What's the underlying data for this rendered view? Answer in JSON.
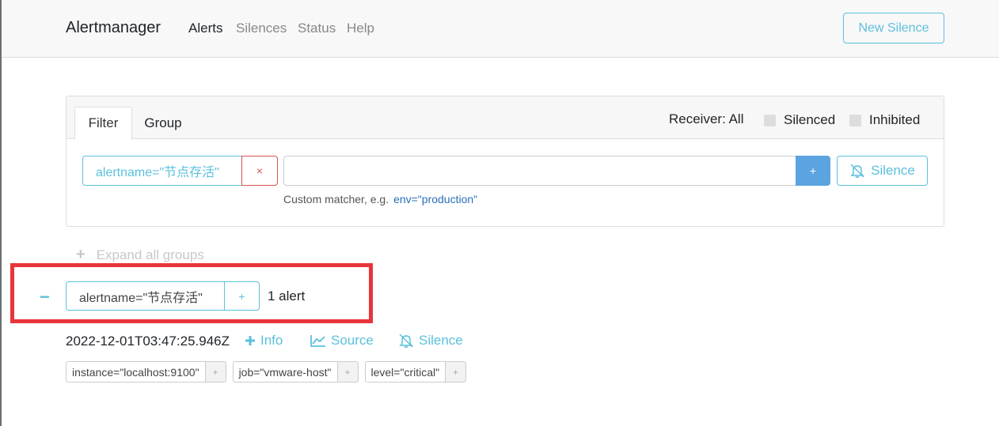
{
  "navbar": {
    "brand": "Alertmanager",
    "links": [
      "Alerts",
      "Silences",
      "Status",
      "Help"
    ],
    "active": "Alerts",
    "new_silence": "New Silence"
  },
  "filter": {
    "tabs": [
      "Filter",
      "Group"
    ],
    "active_tab": "Filter",
    "receiver": "Receiver: All",
    "silenced_label": "Silenced",
    "inhibited_label": "Inhibited",
    "matcher": "alertname=\"节点存活\"",
    "remove_symbol": "×",
    "input_value": "",
    "add_symbol": "+",
    "silence_label": "Silence",
    "hint_text": "Custom matcher, e.g.",
    "hint_example": "env=\"production\""
  },
  "expand_all": "Expand all groups",
  "group": {
    "collapse_symbol": "−",
    "matcher": "alertname=\"节点存活\"",
    "add_symbol": "+",
    "count": "1 alert"
  },
  "alert": {
    "timestamp": "2022-12-01T03:47:25.946Z",
    "info": "Info",
    "source": "Source",
    "silence": "Silence",
    "labels": [
      {
        "text": "instance=\"localhost:9100\"",
        "add": "+"
      },
      {
        "text": "job=\"vmware-host\"",
        "add": "+"
      },
      {
        "text": "level=\"critical\"",
        "add": "+"
      }
    ]
  },
  "colors": {
    "accent": "#5bc0de",
    "danger": "#d9534f",
    "primary": "#5ba4e0",
    "highlight": "#e8353b"
  },
  "icons": [
    "plus-icon",
    "chart-icon",
    "bell-slash-icon",
    "times-icon",
    "minus-icon"
  ]
}
